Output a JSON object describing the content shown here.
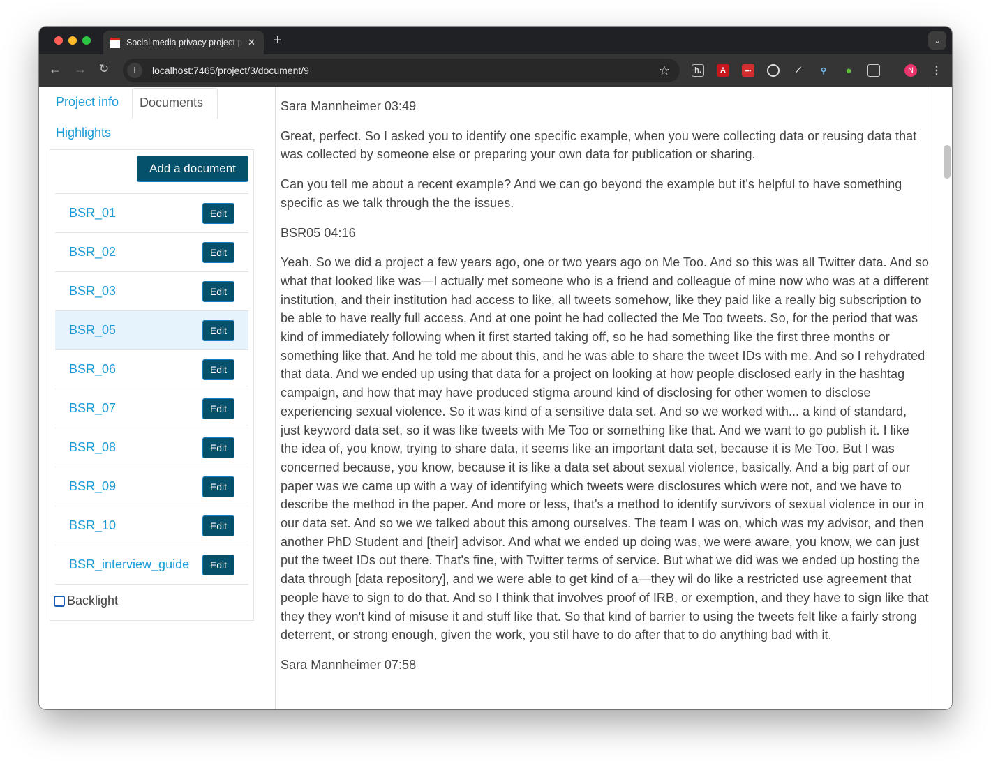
{
  "browser": {
    "tab_title": "Social media privacy project page",
    "url": "localhost:7465/project/3/document/9",
    "profile_initial": "N",
    "traffic_colors": [
      "#ff5f57",
      "#febc2e",
      "#28c840"
    ]
  },
  "sidebar": {
    "tabs": [
      {
        "label": "Project info"
      },
      {
        "label": "Documents",
        "active": true
      },
      {
        "label": "Highlights"
      }
    ],
    "add_button": "Add a document",
    "documents": [
      {
        "name": "BSR_01",
        "edit": "Edit"
      },
      {
        "name": "BSR_02",
        "edit": "Edit"
      },
      {
        "name": "BSR_03",
        "edit": "Edit"
      },
      {
        "name": "BSR_05",
        "edit": "Edit",
        "active": true
      },
      {
        "name": "BSR_06",
        "edit": "Edit"
      },
      {
        "name": "BSR_07",
        "edit": "Edit"
      },
      {
        "name": "BSR_08",
        "edit": "Edit"
      },
      {
        "name": "BSR_09",
        "edit": "Edit"
      },
      {
        "name": "BSR_10",
        "edit": "Edit"
      },
      {
        "name": "BSR_interview_guide",
        "edit": "Edit"
      }
    ],
    "backlight_label": "Backlight",
    "backlight_checked": false
  },
  "document": {
    "paragraphs": [
      "Sara Mannheimer 03:49",
      "Great, perfect. So I asked you to identify one specific example, when you were collecting data or reusing data that was collected by someone else or preparing your own data for publication or sharing.",
      "Can you tell me about a recent example? And we can go beyond the example but it's helpful to have something specific as we talk through the the issues.",
      "BSR05 04:16",
      "Yeah. So we did a project a few years ago, one or two years ago on Me Too. And so this was all Twitter data. And so what that looked like was—I actually met someone who is a friend and colleague of mine now who was at a different institution, and their institution had access to like, all tweets somehow, like they paid like a really big subscription to be able to have really full access. And at one point he had collected the Me Too tweets. So, for the period that was kind of immediately following when it first started taking off, so he had something like the first three months or something like that. And he told me about this, and he was able to share the tweet IDs with me. And so I rehydrated that data. And we ended up using that data for a project on looking at how people disclosed early in the hashtag campaign, and how that may have produced stigma around kind of disclosing for other women to disclose experiencing sexual violence. So it was kind of a sensitive data set. And so we worked with... a kind of standard, just keyword data set, so it was like tweets with Me Too or something like that. And we want to go publish it. I like the idea of, you know, trying to share data, it seems like an important data set, because it is Me Too. But I was concerned because, you know, because it is like a data set about sexual violence, basically. And a big part of our paper was we came up with a way of identifying which tweets were disclosures which were not, and we have to describe the method in the paper. And more or less, that's a method to identify survivors of sexual violence in our in our data set. And so we we talked about this among ourselves. The team I was on, which was my advisor, and then another PhD Student and [their] advisor. And what we ended up doing was, we were aware, you know, we can just put the tweet IDs out there. That's fine, with Twitter terms of service. But what we did was we ended up hosting the data through [data repository], and we were able to get kind of a—they wil do like a restricted use agreement that people have to sign to do that. And so I think that involves proof of IRB, or exemption, and they have to sign like that they they won't kind of misuse it and stuff like that. So that kind of barrier to using the tweets felt like a fairly strong deterrent, or strong enough, given the work, you stil have to do after that to do anything bad with it.",
      "Sara Mannheimer 07:58"
    ]
  }
}
